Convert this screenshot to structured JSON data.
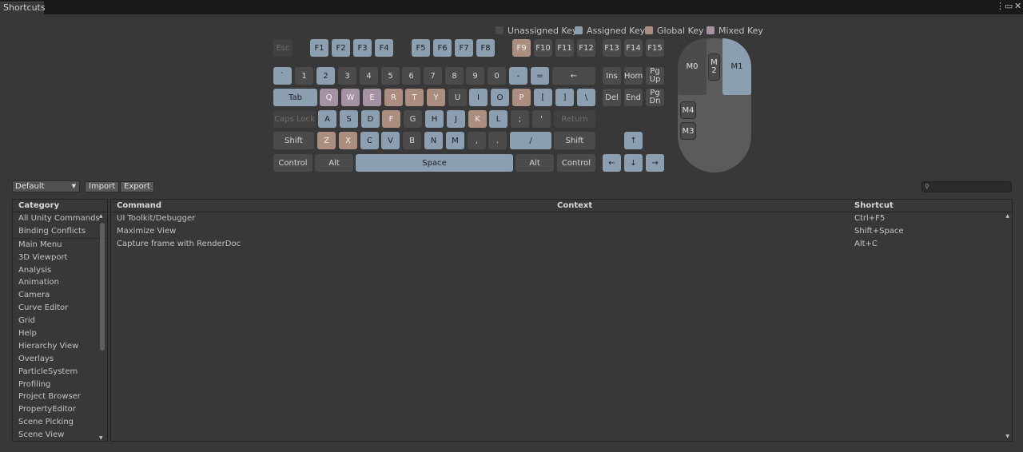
{
  "window": {
    "tab_title": "Shortcuts",
    "menu_icon": "kebab-menu-icon",
    "maximize_icon": "maximize-icon",
    "close_icon": "close-icon"
  },
  "legend": [
    {
      "label": "Unassigned Key",
      "color": "#4b4b4b"
    },
    {
      "label": "Assigned Key",
      "color": "#8c9fb0"
    },
    {
      "label": "Global Key",
      "color": "#ac8e81"
    },
    {
      "label": "Mixed Key",
      "color": "#a592a3"
    }
  ],
  "keyboard": {
    "function_row": {
      "esc": "Esc",
      "f1": "F1",
      "f2": "F2",
      "f3": "F3",
      "f4": "F4",
      "f5": "F5",
      "f6": "F6",
      "f7": "F7",
      "f8": "F8",
      "f9": "F9",
      "f10": "F10",
      "f11": "F11",
      "f12": "F12",
      "f13": "F13",
      "f14": "F14",
      "f15": "F15"
    },
    "number_row": {
      "backtick": "`",
      "k1": "1",
      "k2": "2",
      "k3": "3",
      "k4": "4",
      "k5": "5",
      "k6": "6",
      "k7": "7",
      "k8": "8",
      "k9": "9",
      "k0": "0",
      "minus": "-",
      "equals": "=",
      "backspace": "←"
    },
    "qwerty_row": {
      "tab": "Tab",
      "q": "Q",
      "w": "W",
      "e": "E",
      "r": "R",
      "t": "T",
      "y": "Y",
      "u": "U",
      "i": "I",
      "o": "O",
      "p": "P",
      "lbracket": "[",
      "rbracket": "]",
      "backslash": "\\"
    },
    "home_row": {
      "caps": "Caps Lock",
      "a": "A",
      "s": "S",
      "d": "D",
      "f": "F",
      "g": "G",
      "h": "H",
      "j": "J",
      "k": "K",
      "l": "L",
      "semicolon": ";",
      "quote": "'",
      "return": "Return"
    },
    "shift_row": {
      "lshift": "Shift",
      "z": "Z",
      "x": "X",
      "c": "C",
      "v": "V",
      "b": "B",
      "n": "N",
      "m": "M",
      "comma": ",",
      "period": ".",
      "slash": "/",
      "rshift": "Shift"
    },
    "bottom_row": {
      "lcontrol": "Control",
      "lalt": "Alt",
      "space": "Space",
      "ralt": "Alt",
      "rcontrol": "Control"
    },
    "nav": {
      "ins": "Ins",
      "home": "Hom",
      "pgup_1": "Pg",
      "pgup_2": "Up",
      "del": "Del",
      "end": "End",
      "pgdn_1": "Pg",
      "pgdn_2": "Dn",
      "up": "↑",
      "left": "←",
      "down": "↓",
      "right": "→"
    },
    "mouse": {
      "m0": "M0",
      "m1": "M1",
      "m2_1": "M",
      "m2_2": "2",
      "m3": "M3",
      "m4": "M4"
    }
  },
  "toolbar": {
    "profile": "Default",
    "import_label": "Import",
    "export_label": "Export",
    "search_icon": "search-icon"
  },
  "categories": {
    "header": "Category",
    "items_top": [
      "All Unity Commands",
      "Binding Conflicts"
    ],
    "items": [
      "Main Menu",
      "3D Viewport",
      "Analysis",
      "Animation",
      "Camera",
      "Curve Editor",
      "Grid",
      "Help",
      "Hierarchy View",
      "Overlays",
      "ParticleSystem",
      "Profiling",
      "Project Browser",
      "PropertyEditor",
      "Scene Picking",
      "Scene View"
    ]
  },
  "commands": {
    "headers": {
      "command": "Command",
      "context": "Context",
      "shortcut": "Shortcut"
    },
    "rows": [
      {
        "command": "UI Toolkit/Debugger",
        "context": "",
        "shortcut": "Ctrl+F5"
      },
      {
        "command": "Maximize View",
        "context": "",
        "shortcut": "Shift+Space"
      },
      {
        "command": "Capture frame with RenderDoc",
        "context": "",
        "shortcut": "Alt+C"
      }
    ]
  }
}
